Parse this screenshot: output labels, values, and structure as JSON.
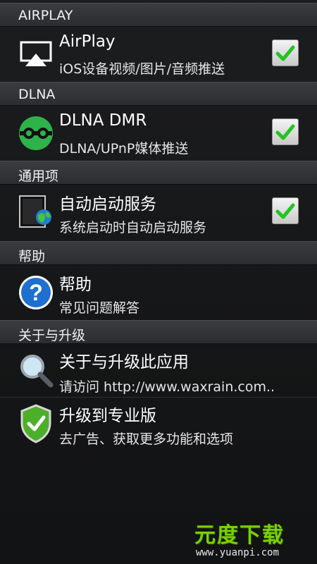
{
  "sections": {
    "airplay": "AIRPLAY",
    "dlna": "DLNA",
    "general": "通用项",
    "help": "帮助",
    "about": "关于与升级"
  },
  "items": {
    "airplay": {
      "title": "AirPlay",
      "subtitle": "iOS设备视频/图片/音频推送",
      "checked": true
    },
    "dlna_dmr": {
      "title": "DLNA DMR",
      "subtitle": "DLNA/UPnP媒体推送",
      "checked": true
    },
    "autostart": {
      "title": "自动启动服务",
      "subtitle": "系统启动时自动启动服务",
      "checked": true
    },
    "help": {
      "title": "帮助",
      "subtitle": "常见问题解答"
    },
    "about": {
      "title": "关于与升级此应用",
      "subtitle": "请访问 http://www.waxrain.com.."
    },
    "upgrade": {
      "title": "升级到专业版",
      "subtitle": "去广告、获取更多功能和选项"
    }
  },
  "watermark": {
    "main": "元度下载",
    "url": "www.yuanpi.com"
  },
  "colors": {
    "check_green": "#22c422",
    "dlna_green": "#2db34a",
    "help_blue": "#1f6fd1",
    "shield_green": "#4caf2a"
  }
}
